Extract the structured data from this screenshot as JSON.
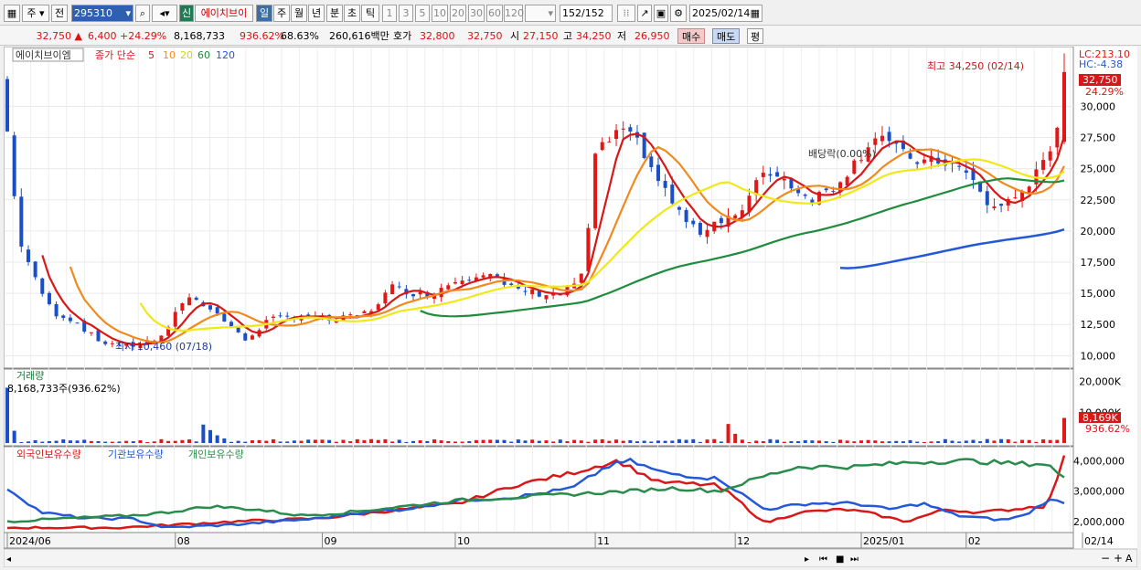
{
  "toolbar": {
    "type_label": "주",
    "period_label": "전",
    "code": "295310",
    "name_badge": "신",
    "name": "에이치브이",
    "intervals": [
      "일",
      "주",
      "월",
      "년",
      "분",
      "초",
      "틱"
    ],
    "minutes": [
      "1",
      "3",
      "5",
      "10",
      "20",
      "30",
      "60",
      "120"
    ],
    "count": "152",
    "count_total": "/152",
    "date": "2025/02/14"
  },
  "quote": {
    "price": "32,750",
    "change": "6,400",
    "change_pct": "+24.29%",
    "volume": "8,168,733",
    "volume_ratio": "936.62%",
    "turnover": "68.63%",
    "amount": "260,616백만",
    "bid_label": "호가",
    "bid1": "32,800",
    "bid2": "32,750",
    "open_label": "시",
    "open": "27,150",
    "high_label": "고",
    "high": "34,250",
    "low_label": "저",
    "low": "26,950",
    "buy": "매수",
    "sell": "매도",
    "eval": "평"
  },
  "price_panel": {
    "stock_name": "에이치브이엠",
    "legend_prefix": "종가 단순",
    "ma_labels": [
      "5",
      "10",
      "20",
      "60",
      "120"
    ],
    "ma_colors": [
      "#d81818",
      "#f08a1e",
      "#f0e818",
      "#1e8c3c",
      "#2358d8"
    ],
    "lc": "LC:213.10",
    "hc": "HC:-4.38",
    "last_price": "32,750",
    "last_change": "24.29%",
    "max_label": "최고 34,250 (02/14)",
    "min_label": "최저 10,460 (07/18)",
    "dividend_label": "배당락(0.00%)"
  },
  "volume_panel": {
    "title": "거래량",
    "info": "8,168,733주(936.62%)",
    "last": "8,169K",
    "last_pct": "936.62%"
  },
  "holder_panel": {
    "legend": [
      "외국인보유수량",
      "기관보유수량",
      "개인보유수량"
    ],
    "colors": [
      "#d81818",
      "#2358d8",
      "#2a8c4c"
    ]
  },
  "chart_data": {
    "type": "line",
    "price_ticks": [
      10000,
      12500,
      15000,
      17500,
      20000,
      22500,
      25000,
      27500,
      30000
    ],
    "price_tick_labels": [
      "10,000",
      "12,500",
      "15,000",
      "17,500",
      "20,000",
      "22,500",
      "25,000",
      "27,500",
      "30,000"
    ],
    "price_range": [
      9000,
      34500
    ],
    "volume_ticks_labels": [
      "20,000K",
      "10,000K"
    ],
    "volume_ticks": [
      20000,
      10000
    ],
    "volume_range": [
      0,
      22000
    ],
    "holder_ticks_labels": [
      "4,000,000",
      "3,000,000",
      "2,000,000"
    ],
    "holder_ticks": [
      4000000,
      3000000,
      2000000
    ],
    "holder_range": [
      1700000,
      4400000
    ],
    "x_axis_labels": [
      "2024/06",
      "08",
      "09",
      "10",
      "11",
      "12",
      "2025/01",
      "02",
      "02/14"
    ],
    "x_axis_label_index": [
      0,
      28,
      52,
      73,
      96,
      119,
      140,
      157,
      173
    ],
    "bars": 152
  }
}
